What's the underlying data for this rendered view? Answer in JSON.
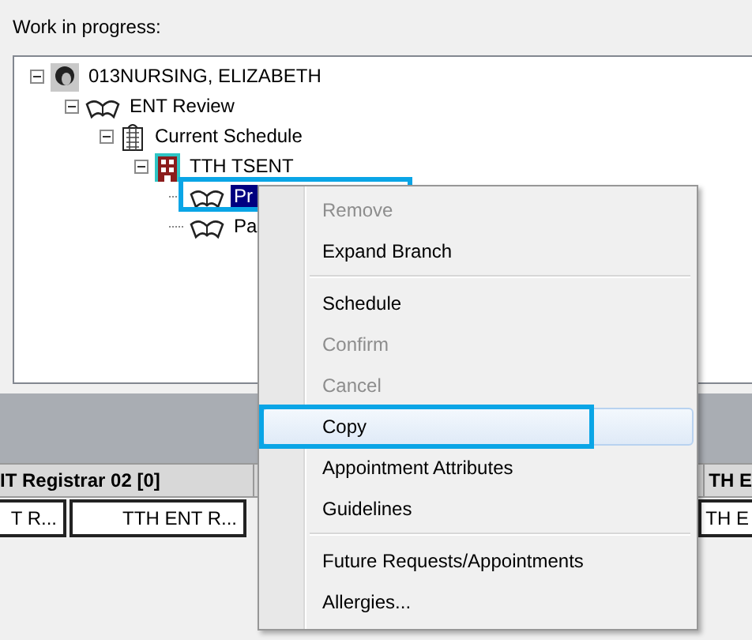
{
  "section_label": "Work in progress:",
  "tree": [
    {
      "label": "013NURSING, ELIZABETH",
      "kind": "person",
      "expanded": true,
      "selected": false,
      "annotated": false,
      "children": [
        {
          "label": "ENT Review",
          "kind": "book",
          "expanded": true,
          "selected": false,
          "annotated": false,
          "children": [
            {
              "label": "Current Schedule",
              "kind": "schedule",
              "expanded": true,
              "selected": false,
              "annotated": false,
              "children": [
                {
                  "label": "TTH TSENT",
                  "kind": "building",
                  "expanded": true,
                  "selected": false,
                  "annotated": false,
                  "children": [
                    {
                      "label": "Pr",
                      "kind": "book",
                      "selected": true,
                      "annotated": true
                    },
                    {
                      "label": "Pa",
                      "kind": "book",
                      "selected": false,
                      "annotated": false
                    }
                  ]
                }
              ]
            }
          ]
        }
      ]
    }
  ],
  "grid": {
    "header": [
      {
        "label": "IT Registrar 02 [0]"
      },
      {
        "label": "TH E"
      }
    ],
    "cells": [
      {
        "label": "T R..."
      },
      {
        "label": "TTH ENT R..."
      },
      {
        "label": "TH E"
      }
    ]
  },
  "context_menu": [
    {
      "kind": "item",
      "label": "Remove",
      "disabled": true,
      "highlighted": false,
      "annotated": false
    },
    {
      "kind": "item",
      "label": "Expand Branch",
      "disabled": false,
      "highlighted": false,
      "annotated": false
    },
    {
      "kind": "separator"
    },
    {
      "kind": "item",
      "label": "Schedule",
      "disabled": false,
      "highlighted": false,
      "annotated": false
    },
    {
      "kind": "item",
      "label": "Confirm",
      "disabled": true,
      "highlighted": false,
      "annotated": false
    },
    {
      "kind": "item",
      "label": "Cancel",
      "disabled": true,
      "highlighted": false,
      "annotated": false
    },
    {
      "kind": "item",
      "label": "Copy",
      "disabled": false,
      "highlighted": true,
      "annotated": true
    },
    {
      "kind": "item",
      "label": "Appointment Attributes",
      "disabled": false,
      "highlighted": false,
      "annotated": false
    },
    {
      "kind": "item",
      "label": "Guidelines",
      "disabled": false,
      "highlighted": false,
      "annotated": false
    },
    {
      "kind": "separator"
    },
    {
      "kind": "item",
      "label": "Future Requests/Appointments",
      "disabled": false,
      "highlighted": false,
      "annotated": false
    },
    {
      "kind": "item",
      "label": "Allergies...",
      "disabled": false,
      "highlighted": false,
      "annotated": false
    }
  ]
}
